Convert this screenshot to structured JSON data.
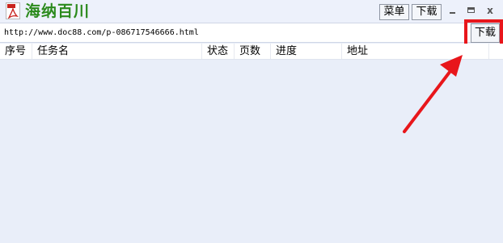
{
  "app": {
    "title": "海纳百川",
    "icon": "pdf-app-icon"
  },
  "menu": {
    "menu_label": "菜单",
    "download_label": "下载"
  },
  "window_controls": [
    "minimize-icon",
    "maximize-icon",
    "close-icon"
  ],
  "url_bar": {
    "value": "http://www.doc88.com/p-086717546666.html",
    "download_button": "下载"
  },
  "table": {
    "columns": [
      "序号",
      "任务名",
      "状态",
      "页数",
      "进度",
      "地址"
    ],
    "rows": []
  },
  "annotation": {
    "highlight_color": "#e8161b",
    "arrow_color": "#e8161b"
  },
  "colors": {
    "title_green": "#2b8a1c",
    "background": "#e9eef9"
  }
}
